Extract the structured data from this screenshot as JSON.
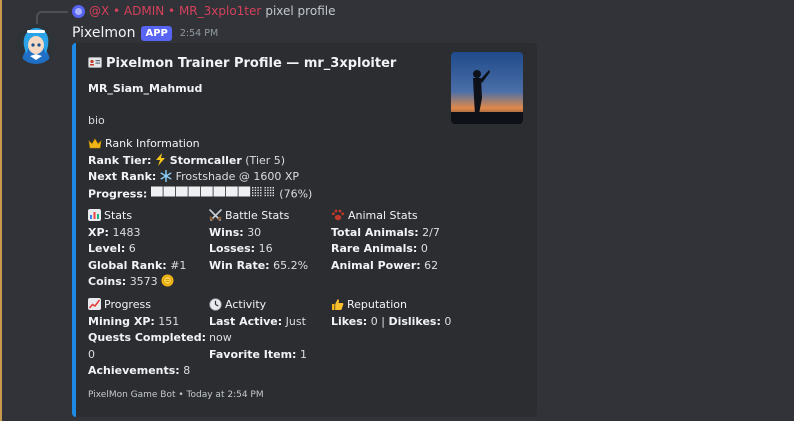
{
  "reply": {
    "user": "@X • ADMIN • MR_3xplo1ter",
    "text": "pixel profile"
  },
  "message": {
    "author": "Pixelmon",
    "badge": "APP",
    "time": "2:54 PM"
  },
  "embed": {
    "accent_color": "#1e88e5",
    "title_icon": "id-card-icon",
    "title": "Pixelmon Trainer Profile — mr_3xploiter",
    "name": "MR_Siam_Mahmud",
    "bio": "bio",
    "rank": {
      "heading_icon": "crown-icon",
      "heading": "Rank Information",
      "tier_label": "Rank Tier:",
      "tier_icon": "lightning-icon",
      "tier_name": "Stormcaller",
      "tier_level": "(Tier 5)",
      "next_label": "Next Rank:",
      "next_icon": "snowflake-icon",
      "next_value": "Frostshade @ 1600 XP",
      "progress_label": "Progress:",
      "progress_fraction": 0.76,
      "progress_text": "(76%)"
    },
    "stats": {
      "heading_icon": "bar-chart-icon",
      "heading": "Stats",
      "xp_label": "XP:",
      "xp": "1483",
      "level_label": "Level:",
      "level": "6",
      "global_label": "Global Rank:",
      "global": "#1",
      "coins_label": "Coins:",
      "coins": "3573",
      "coin_icon": "coin-icon"
    },
    "battle": {
      "heading_icon": "crossed-swords-icon",
      "heading": "Battle Stats",
      "wins_label": "Wins:",
      "wins": "30",
      "losses_label": "Losses:",
      "losses": "16",
      "rate_label": "Win Rate:",
      "rate": "65.2%"
    },
    "animal": {
      "heading_icon": "paw-icon",
      "heading": "Animal Stats",
      "total_label": "Total Animals:",
      "total": "2/7",
      "rare_label": "Rare Animals:",
      "rare": "0",
      "power_label": "Animal Power:",
      "power": "62"
    },
    "progress": {
      "heading_icon": "chart-up-icon",
      "heading": "Progress",
      "mining_label": "Mining XP:",
      "mining": "151",
      "quests_label": "Quests Completed:",
      "quests": "0",
      "ach_label": "Achievements:",
      "ach": "8"
    },
    "activity": {
      "heading_icon": "clock-icon",
      "heading": "Activity",
      "last_label": "Last Active:",
      "last_1": "Just",
      "last_2": "now",
      "fav_label": "Favorite Item:",
      "fav": "1"
    },
    "reputation": {
      "heading_icon": "thumbs-up-icon",
      "heading": "Reputation",
      "likes_label": "Likes:",
      "likes": "0",
      "sep": "|",
      "dislikes_label": "Dislikes:",
      "dislikes": "0"
    },
    "footer": "PixelMon Game Bot • Today at 2:54 PM"
  }
}
